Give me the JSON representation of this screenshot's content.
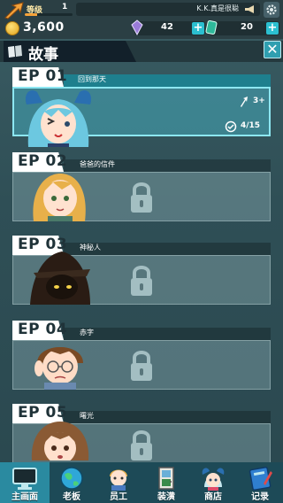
{
  "topbar": {
    "level_label": "等级",
    "level_value": "1",
    "xp_fraction": 0.25,
    "player_name": "K.K.真是很聪",
    "coins": "3,600",
    "gems": "42",
    "tickets": "20"
  },
  "story": {
    "title": "故事"
  },
  "episodes": [
    {
      "code": "EP 01",
      "name": "回到那天",
      "locked": false,
      "required_level": "3+",
      "progress": "4/15"
    },
    {
      "code": "EP 02",
      "name": "爸爸的信件",
      "locked": true
    },
    {
      "code": "EP 03",
      "name": "神秘人",
      "locked": true
    },
    {
      "code": "EP 04",
      "name": "赤字",
      "locked": true
    },
    {
      "code": "EP 05",
      "name": "曙光",
      "locked": true
    }
  ],
  "nav": [
    {
      "label": "主画面",
      "icon": "monitor-icon"
    },
    {
      "label": "老板",
      "icon": "globe-icon"
    },
    {
      "label": "员工",
      "icon": "employee-icon"
    },
    {
      "label": "装潢",
      "icon": "door-icon"
    },
    {
      "label": "商店",
      "icon": "shop-character-icon"
    },
    {
      "label": "记录",
      "icon": "record-book-icon"
    }
  ],
  "colors": {
    "accent": "#2bbfd0",
    "active_card_border": "#8de7f2",
    "coin": "#f4c23a",
    "background": "#2f4f56"
  }
}
